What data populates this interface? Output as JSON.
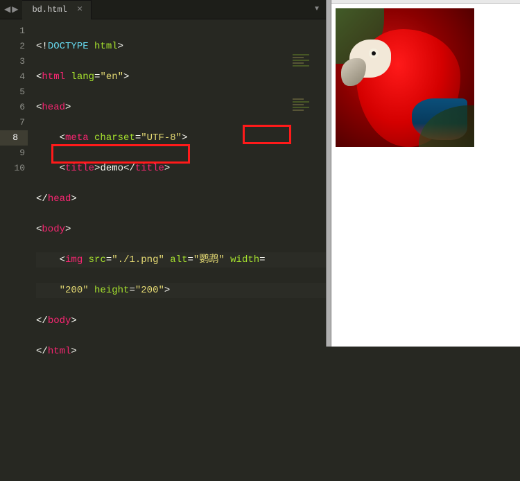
{
  "tabs": {
    "file": "bd.html",
    "close_glyph": "×"
  },
  "nav": {
    "left": "◀",
    "right": "▶",
    "dropdown": "▼"
  },
  "gutter": [
    "1",
    "2",
    "3",
    "4",
    "5",
    "6",
    "7",
    "8",
    "",
    "9",
    "10"
  ],
  "code": {
    "l1": {
      "p1": "<!",
      "kw": "DOCTYPE",
      "sp": " ",
      "attr": "html",
      "p2": ">"
    },
    "l2": {
      "p1": "<",
      "tag": "html",
      "sp": " ",
      "attr": "lang",
      "eq": "=",
      "str": "\"en\"",
      "p2": ">"
    },
    "l3": {
      "p1": "<",
      "tag": "head",
      "p2": ">"
    },
    "l4": {
      "p1": "<",
      "tag": "meta",
      "sp": " ",
      "attr": "charset",
      "eq": "=",
      "str": "\"UTF-8\"",
      "p2": ">"
    },
    "l5": {
      "p1": "<",
      "tag": "title",
      "p2": ">",
      "txt": "demo",
      "p3": "</",
      "tag2": "title",
      "p4": ">"
    },
    "l6": {
      "p1": "</",
      "tag": "head",
      "p2": ">"
    },
    "l7": {
      "p1": "<",
      "tag": "body",
      "p2": ">"
    },
    "l8a": {
      "p1": "<",
      "tag": "img",
      "sp": " ",
      "a1": "src",
      "eq1": "=",
      "s1": "\"./1.png\"",
      "sp2": " ",
      "a2": "alt",
      "eq2": "=",
      "s2": "\"鹦鹉\"",
      "sp3": " ",
      "a3": "width",
      "eq3": "="
    },
    "l8b": {
      "s1": "\"200\"",
      "sp": " ",
      "a1": "height",
      "eq": "=",
      "s2": "\"200\"",
      "p2": ">"
    },
    "l9": {
      "p1": "</",
      "tag": "body",
      "p2": ">"
    },
    "l10": {
      "p1": "</",
      "tag": "html",
      "p2": ">"
    }
  },
  "preview": {
    "image_alt": "鹦鹉",
    "width": "200",
    "height": "200"
  },
  "annotations": {
    "box1": "width=",
    "box2": "\"200\" height=\"200\""
  }
}
